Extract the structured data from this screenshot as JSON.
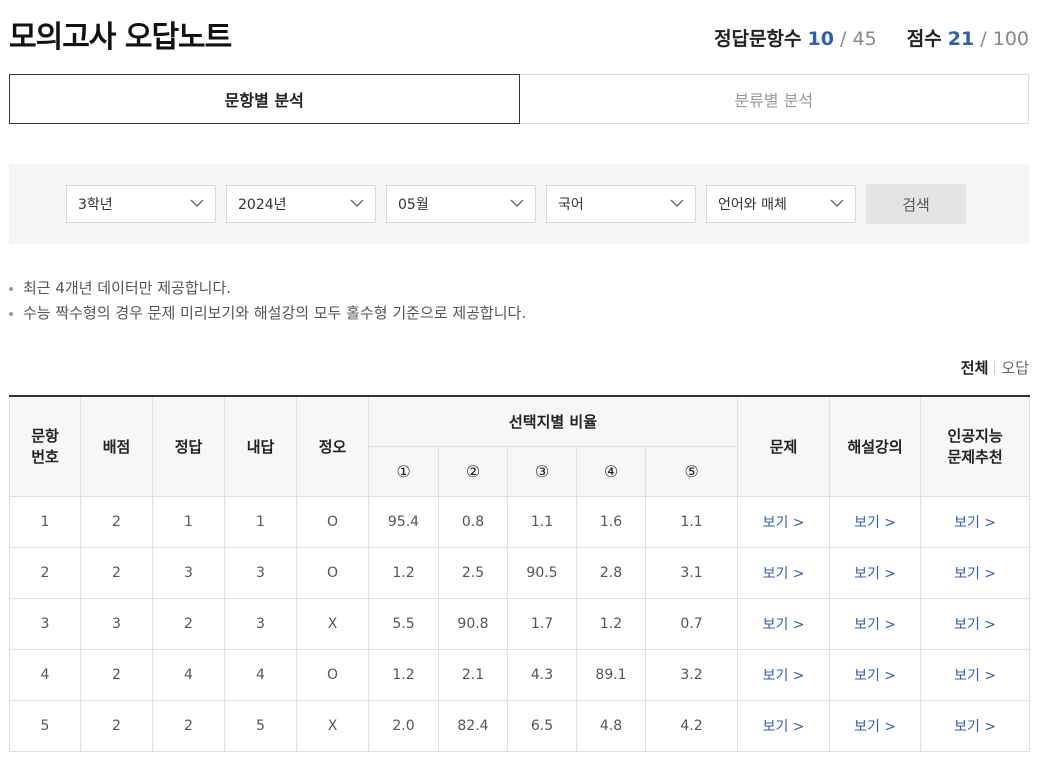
{
  "header": {
    "title": "모의고사 오답노트",
    "correct_label": "정답문항수",
    "correct_count": "10",
    "question_total": "45",
    "score_label": "점수",
    "score": "21",
    "score_total": "100",
    "separator": "/"
  },
  "tabs": [
    {
      "label": "문항별 분석",
      "active": true
    },
    {
      "label": "분류별 분석",
      "active": false
    }
  ],
  "filters": {
    "grade": "3학년",
    "year": "2024년",
    "month": "05월",
    "subject": "국어",
    "elective": "언어와 매체",
    "search_label": "검색"
  },
  "notes": [
    "최근 4개년 데이터만 제공합니다.",
    "수능 짝수형의 경우 문제 미리보기와 해설강의 모두 홀수형 기준으로 제공합니다."
  ],
  "view_toggle": {
    "all": "전체",
    "wrong": "오답"
  },
  "table": {
    "headers": {
      "number": "문항\n번호",
      "points": "배점",
      "answer": "정답",
      "my_answer": "내답",
      "result": "정오",
      "choice_ratio": "선택지별 비율",
      "choices": [
        "①",
        "②",
        "③",
        "④",
        "⑤"
      ],
      "problem": "문제",
      "lecture": "해설강의",
      "ai": "인공지능\n문제추천"
    },
    "link_label": "보기 >",
    "rows": [
      {
        "no": "1",
        "points": "2",
        "answer": "1",
        "mine": "1",
        "result": "O",
        "ratios": [
          "95.4",
          "0.8",
          "1.1",
          "1.6",
          "1.1"
        ]
      },
      {
        "no": "2",
        "points": "2",
        "answer": "3",
        "mine": "3",
        "result": "O",
        "ratios": [
          "1.2",
          "2.5",
          "90.5",
          "2.8",
          "3.1"
        ]
      },
      {
        "no": "3",
        "points": "3",
        "answer": "2",
        "mine": "3",
        "result": "X",
        "ratios": [
          "5.5",
          "90.8",
          "1.7",
          "1.2",
          "0.7"
        ]
      },
      {
        "no": "4",
        "points": "2",
        "answer": "4",
        "mine": "4",
        "result": "O",
        "ratios": [
          "1.2",
          "2.1",
          "4.3",
          "89.1",
          "3.2"
        ]
      },
      {
        "no": "5",
        "points": "2",
        "answer": "2",
        "mine": "5",
        "result": "X",
        "ratios": [
          "2.0",
          "82.4",
          "6.5",
          "4.8",
          "4.2"
        ]
      }
    ]
  },
  "colors": {
    "accent_blue": "#2f5fb3",
    "wrong_red": "#d9333a",
    "tab_border": "#2b3a55"
  },
  "icons": {
    "select_arrow": "chevron-down-icon"
  }
}
